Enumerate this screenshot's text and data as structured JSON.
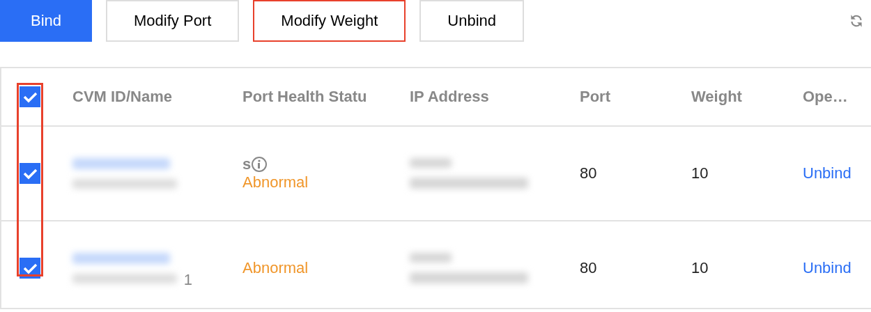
{
  "toolbar": {
    "buttons": [
      {
        "label": "Bind",
        "kind": "primary",
        "highlighted": false
      },
      {
        "label": "Modify Port",
        "kind": "default",
        "highlighted": false
      },
      {
        "label": "Modify Weight",
        "kind": "default",
        "highlighted": true
      },
      {
        "label": "Unbind",
        "kind": "default",
        "highlighted": false
      }
    ]
  },
  "table": {
    "select_all_checked": true,
    "checkbox_column_highlighted": true,
    "columns": [
      "CVM ID/Name",
      "Port Health Statu",
      "IP Address",
      "Port",
      "Weight",
      "Ope…"
    ],
    "rows": [
      {
        "checked": true,
        "name_tail": "",
        "status_note": "s",
        "status": "Abnormal",
        "port": "80",
        "weight": "10",
        "action": "Unbind"
      },
      {
        "checked": true,
        "name_tail": "1",
        "status_note": "",
        "status": "Abnormal",
        "port": "80",
        "weight": "10",
        "action": "Unbind"
      }
    ]
  }
}
